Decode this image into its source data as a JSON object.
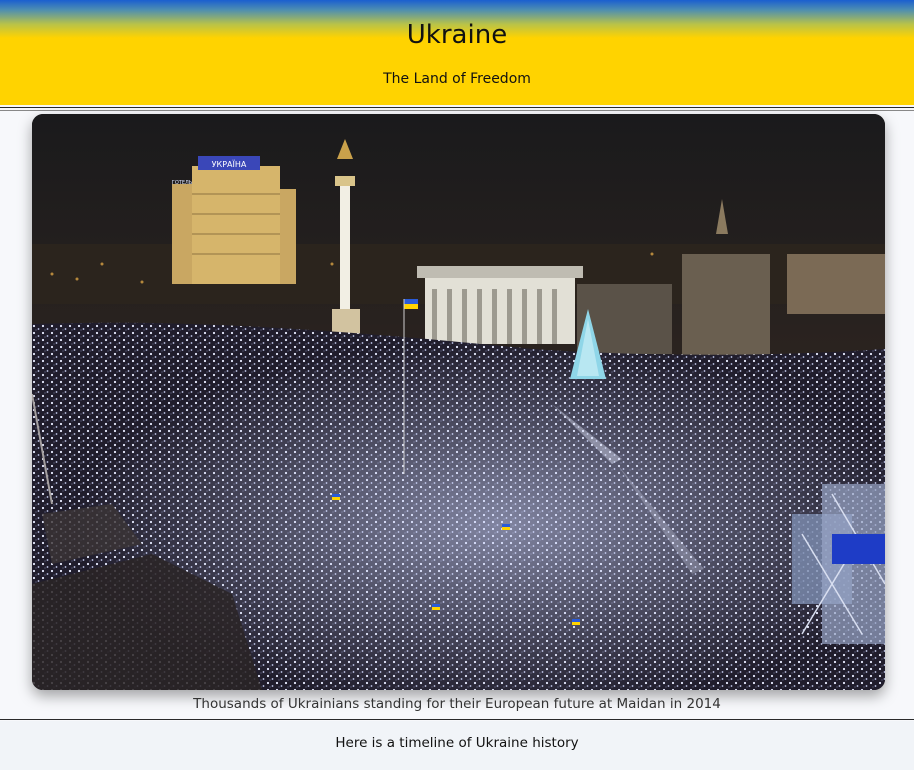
{
  "header": {
    "title": "Ukraine",
    "subtitle": "The Land of Freedom",
    "colors": {
      "blue": "#1a5fd0",
      "yellow": "#ffd300"
    }
  },
  "photo": {
    "sign_text": "УКРАЇНА",
    "hotel_text": "ГОТЕЛЬ"
  },
  "caption": "Thousands of Ukrainians standing for their European future at Maidan in 2014",
  "footer": {
    "text": "Here is a timeline of Ukraine history"
  }
}
